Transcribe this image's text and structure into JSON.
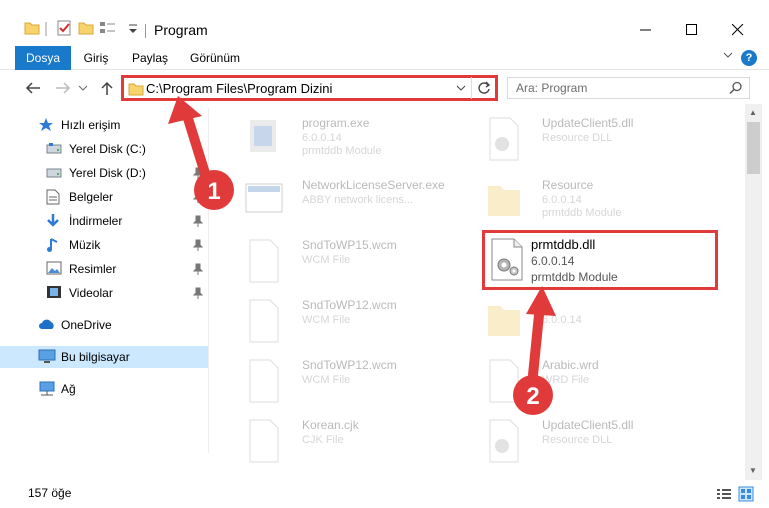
{
  "window": {
    "title": "Program",
    "minimize_label": "–",
    "maximize_label": "□",
    "close_label": "✕"
  },
  "ribbon": {
    "tabs": [
      "Dosya",
      "Giriş",
      "Paylaş",
      "Görünüm"
    ],
    "help": "?"
  },
  "address": {
    "path": "C:\\Program Files\\Program Dizini"
  },
  "search": {
    "placeholder": "Ara: Program"
  },
  "sidebar": {
    "items": [
      {
        "label": "Hızlı erişim",
        "icon": "star-icon"
      },
      {
        "label": "Yerel Disk (C:)",
        "icon": "drive-icon"
      },
      {
        "label": "Yerel Disk (D:)",
        "icon": "drive-icon"
      },
      {
        "label": "Belgeler",
        "icon": "documents-icon"
      },
      {
        "label": "İndirmeler",
        "icon": "download-icon"
      },
      {
        "label": "Müzik",
        "icon": "music-icon"
      },
      {
        "label": "Resimler",
        "icon": "pictures-icon"
      },
      {
        "label": "Videolar",
        "icon": "videos-icon"
      },
      {
        "label": "OneDrive",
        "icon": "cloud-icon"
      },
      {
        "label": "Bu bilgisayar",
        "icon": "computer-icon"
      },
      {
        "label": "Ağ",
        "icon": "network-icon"
      }
    ]
  },
  "files": [
    {
      "name": "program.exe",
      "line1": "6.0.0.14",
      "line2": "prmtddb Module"
    },
    {
      "name": "UpdateClient5.dll",
      "line1": "Resource DLL",
      "line2": ""
    },
    {
      "name": "NetworkLicenseServer.exe",
      "line1": "ABBY network licens...",
      "line2": ""
    },
    {
      "name": "Resource",
      "line1": "6.0.0.14",
      "line2": "prmtddb Module"
    },
    {
      "name": "SndToWP15.wcm",
      "line1": "WCM File",
      "line2": ""
    },
    {
      "name": "SndToWP12.wcm",
      "line1": "WCM File",
      "line2": ""
    },
    {
      "name": "",
      "line1": "6.0.0.14",
      "line2": ""
    },
    {
      "name": "SndToWP12.wcm",
      "line1": "WCM File",
      "line2": ""
    },
    {
      "name": "Arabic.wrd",
      "line1": "WRD File",
      "line2": ""
    },
    {
      "name": "Korean.cjk",
      "line1": "CJK File",
      "line2": ""
    },
    {
      "name": "UpdateClient5.dll",
      "line1": "Resource DLL",
      "line2": ""
    }
  ],
  "highlighted_file": {
    "name": "prmtddb.dll",
    "version": "6.0.0.14",
    "description": "prmtddb Module"
  },
  "annotations": {
    "step1": "1",
    "step2": "2",
    "color": "#e03a3a"
  },
  "status": {
    "count": "157 öğe"
  }
}
